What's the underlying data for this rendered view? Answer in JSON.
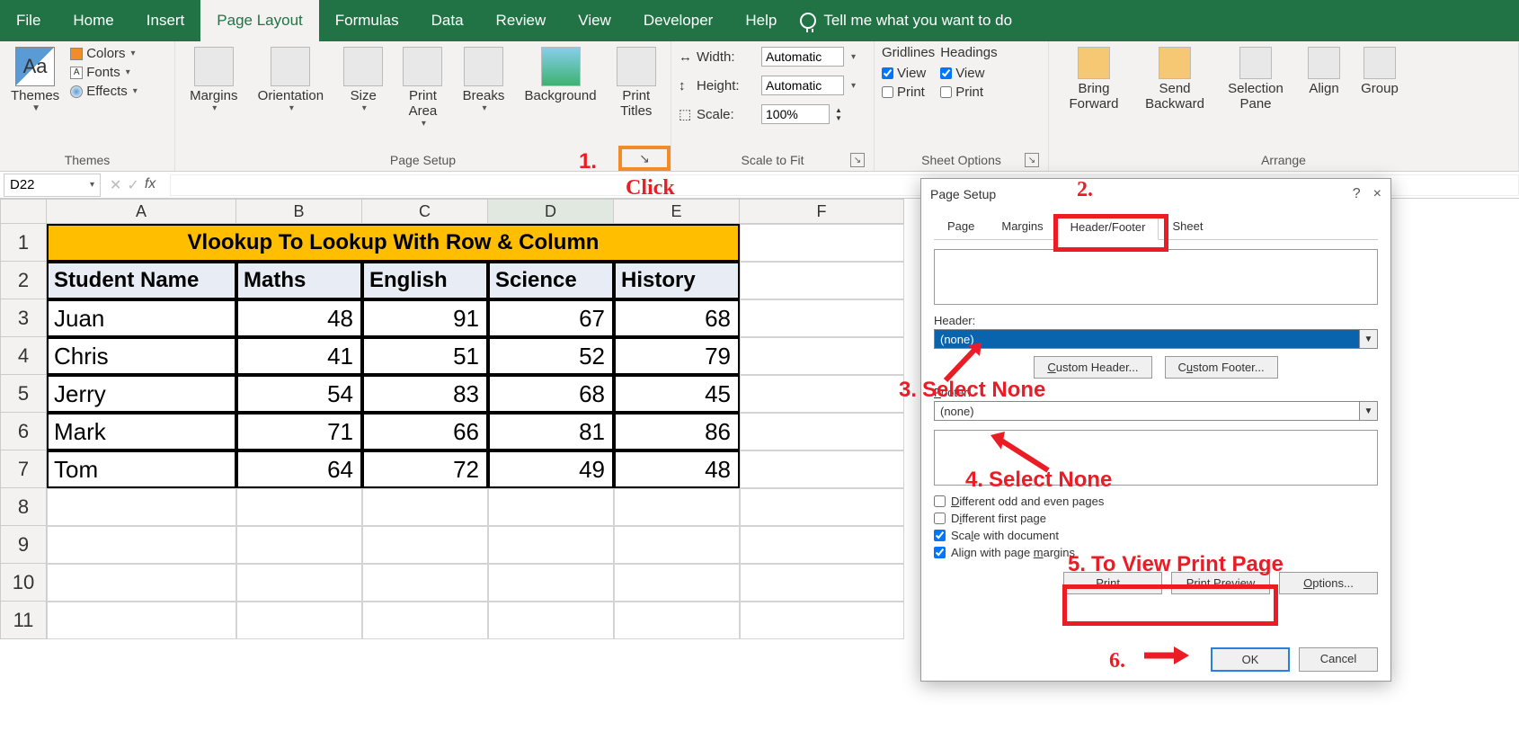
{
  "menu": {
    "items": [
      "File",
      "Home",
      "Insert",
      "Page Layout",
      "Formulas",
      "Data",
      "Review",
      "View",
      "Developer",
      "Help"
    ],
    "active": "Page Layout",
    "tellme": "Tell me what you want to do"
  },
  "ribbon": {
    "themes": {
      "label": "Themes",
      "themes_btn": "Themes",
      "colors": "Colors",
      "fonts": "Fonts",
      "effects": "Effects"
    },
    "pagesetup": {
      "label": "Page Setup",
      "margins": "Margins",
      "orientation": "Orientation",
      "size": "Size",
      "printarea": "Print\nArea",
      "breaks": "Breaks",
      "background": "Background",
      "titles": "Print\nTitles"
    },
    "scale": {
      "label": "Scale to Fit",
      "width_lbl": "Width:",
      "width_val": "Automatic",
      "height_lbl": "Height:",
      "height_val": "Automatic",
      "scale_lbl": "Scale:",
      "scale_val": "100%"
    },
    "sheetoptions": {
      "label": "Sheet Options",
      "gridlines": "Gridlines",
      "headings": "Headings",
      "view": "View",
      "print": "Print",
      "gl_view": true,
      "gl_print": false,
      "hd_view": true,
      "hd_print": false
    },
    "arrange": {
      "label": "Arrange",
      "forward": "Bring\nForward",
      "backward": "Send\nBackward",
      "selpane": "Selection\nPane",
      "align": "Align",
      "group": "Group"
    }
  },
  "namebox": "D22",
  "grid": {
    "cols": [
      "A",
      "B",
      "C",
      "D",
      "E",
      "F"
    ],
    "title": "Vlookup To Lookup With Row & Column",
    "headers": [
      "Student Name",
      "Maths",
      "English",
      "Science",
      "History"
    ],
    "rows": [
      {
        "name": "Juan",
        "v": [
          48,
          91,
          67,
          68
        ]
      },
      {
        "name": "Chris",
        "v": [
          41,
          51,
          52,
          79
        ]
      },
      {
        "name": "Jerry",
        "v": [
          54,
          83,
          68,
          45
        ]
      },
      {
        "name": "Mark",
        "v": [
          71,
          66,
          81,
          86
        ]
      },
      {
        "name": "Tom",
        "v": [
          64,
          72,
          49,
          48
        ]
      }
    ],
    "rownums": [
      "1",
      "2",
      "3",
      "4",
      "5",
      "6",
      "7",
      "8",
      "9",
      "10",
      "11"
    ]
  },
  "dialog": {
    "title": "Page Setup",
    "tabs": [
      "Page",
      "Margins",
      "Header/Footer",
      "Sheet"
    ],
    "active_tab": "Header/Footer",
    "header_lbl": "Header:",
    "header_val": "(none)",
    "footer_lbl": "Footer:",
    "footer_val": "(none)",
    "custom_header": "Custom Header...",
    "custom_footer": "Custom Footer...",
    "chk_oddeven": "Different odd and even pages",
    "chk_firstpage": "Different first page",
    "chk_scale": "Scale with document",
    "chk_align": "Align with page margins",
    "print_btn": "Print...",
    "preview_btn": "Print Preview",
    "options_btn": "Options...",
    "ok": "OK",
    "cancel": "Cancel",
    "help": "?",
    "close": "×"
  },
  "anno": {
    "a1": "1.",
    "click": "Click",
    "a2": "2.",
    "a3": "3.",
    "a3txt": "Select None",
    "a4": "4.",
    "a4txt": "Select None",
    "a5": "5.",
    "a5txt": "To View Print Page",
    "a6": "6."
  }
}
